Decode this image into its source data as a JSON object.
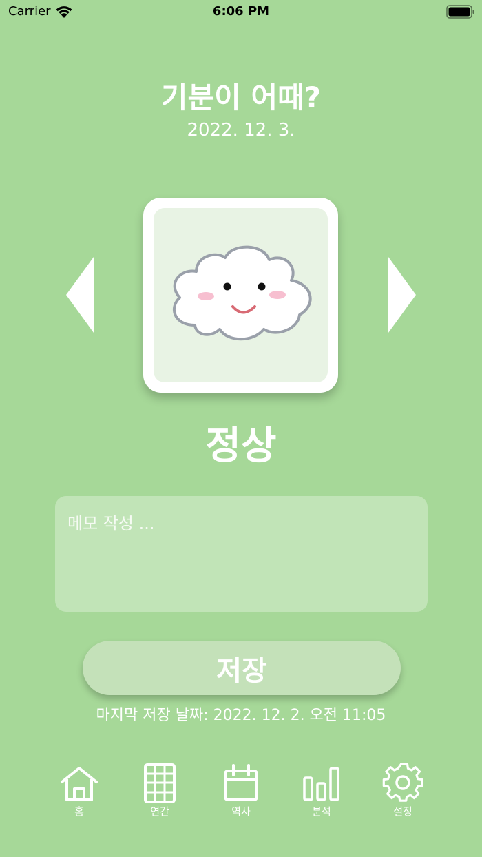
{
  "status_bar": {
    "carrier": "Carrier",
    "time": "6:06 PM"
  },
  "header": {
    "title": "기분이 어때?",
    "date": "2022. 12. 3."
  },
  "mood": {
    "label": "정상",
    "icon": "cloud-face"
  },
  "memo": {
    "placeholder": "메모 작성 ...",
    "value": ""
  },
  "save": {
    "label": "저장",
    "last_saved": "마지막 저장 날짜: 2022. 12. 2. 오전 11:05"
  },
  "tabs": [
    {
      "label": "홈",
      "icon": "home-icon"
    },
    {
      "label": "연간",
      "icon": "grid-icon"
    },
    {
      "label": "역사",
      "icon": "calendar-icon"
    },
    {
      "label": "분석",
      "icon": "bar-chart-icon"
    },
    {
      "label": "설정",
      "icon": "gear-icon"
    }
  ],
  "colors": {
    "background": "#a6d898",
    "card_inner": "#e8f3e4",
    "button": "#c4e1b9",
    "text": "#ffffff"
  }
}
